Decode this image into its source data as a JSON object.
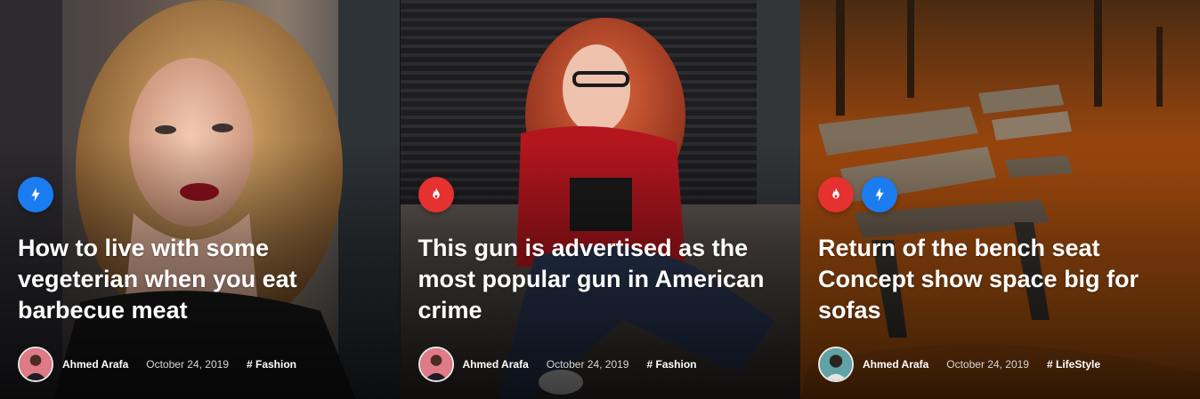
{
  "cards": [
    {
      "badges": [
        "flash-icon"
      ],
      "title": "How to live with some vegeterian when you eat barbecue meat",
      "author": "Ahmed Arafa",
      "date": "October 24, 2019",
      "tag": "# Fashion"
    },
    {
      "badges": [
        "fire-icon"
      ],
      "title": "This gun is advertised as the most popular gun in American crime",
      "author": "Ahmed Arafa",
      "date": "October 24, 2019",
      "tag": "# Fashion"
    },
    {
      "badges": [
        "fire-icon",
        "flash-icon"
      ],
      "title": "Return of the bench seat Concept show space big for sofas",
      "author": "Ahmed Arafa",
      "date": "October 24, 2019",
      "tag": "# LifeStyle"
    }
  ],
  "colors": {
    "fire_badge": "#e5322f",
    "flash_badge": "#1b7cf0",
    "title_text": "#ffffff",
    "meta_date": "#d6d6d6"
  }
}
